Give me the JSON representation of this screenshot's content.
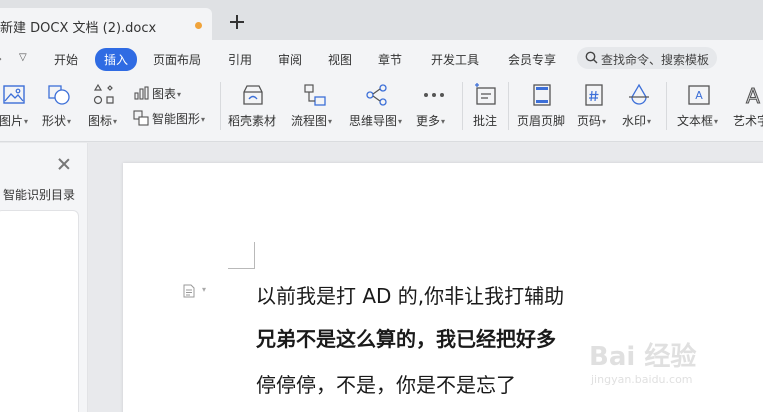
{
  "tab": {
    "title": "新建 DOCX 文档 (2).docx"
  },
  "menu": {
    "items": [
      "开始",
      "插入",
      "页面布局",
      "引用",
      "审阅",
      "视图",
      "章节",
      "开发工具",
      "会员专享"
    ],
    "active": "插入",
    "search_label": "查找命令、搜索模板"
  },
  "ribbon": {
    "picture": "图片",
    "shape": "形状",
    "icons": "图标",
    "chart": "图表",
    "smart_graphic": "智能图形",
    "material": "稻壳素材",
    "flowchart": "流程图",
    "mindmap": "思维导图",
    "more": "更多",
    "comment": "批注",
    "header_footer": "页眉页脚",
    "page_number": "页码",
    "watermark": "水印",
    "textbox": "文本框",
    "wordart": "艺术字"
  },
  "side_panel": {
    "title": "智能识别目录"
  },
  "document": {
    "lines": [
      "以前我是打 AD 的,你非让我打辅助",
      "兄弟不是这么算的，我已经把好多",
      "停停停，不是，你是不是忘了"
    ]
  },
  "watermark": {
    "brand": "Bai 经验",
    "url": "jingyan.baidu.com"
  },
  "colors": {
    "accent": "#2f6be3",
    "tab_dot": "#f0a33a"
  }
}
